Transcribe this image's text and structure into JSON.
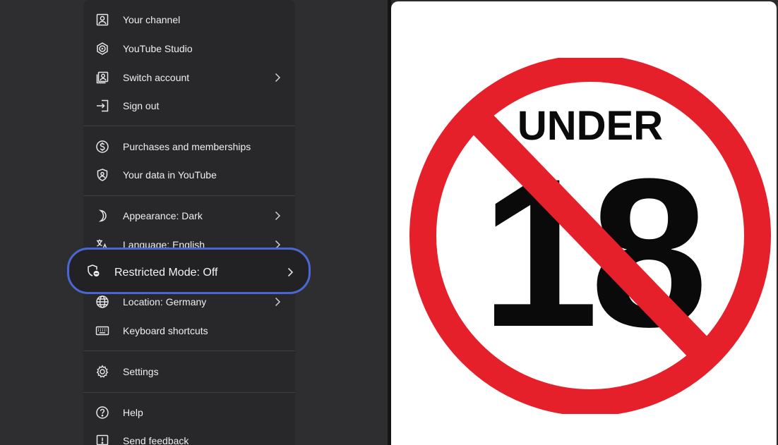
{
  "menu": {
    "account_items": [
      {
        "label": "Your channel",
        "icon": "account-box-icon"
      },
      {
        "label": "YouTube Studio",
        "icon": "studio-icon"
      },
      {
        "label": "Switch account",
        "icon": "switch-account-icon",
        "has_submenu": true
      },
      {
        "label": "Sign out",
        "icon": "sign-out-icon"
      }
    ],
    "data_items": [
      {
        "label": "Purchases and memberships",
        "icon": "dollar-icon"
      },
      {
        "label": "Your data in YouTube",
        "icon": "shield-person-icon"
      }
    ],
    "settings_items": [
      {
        "label": "Appearance: Dark",
        "icon": "moon-icon",
        "has_submenu": true
      },
      {
        "label": "Language: English",
        "icon": "translate-icon",
        "has_submenu": true
      },
      {
        "label": "Restricted Mode: Off",
        "icon": "restricted-mode-icon",
        "has_submenu": true,
        "highlighted": true
      },
      {
        "label": "Location: Germany",
        "icon": "globe-icon",
        "has_submenu": true
      },
      {
        "label": "Keyboard shortcuts",
        "icon": "keyboard-icon"
      }
    ],
    "settings": {
      "label": "Settings",
      "icon": "gear-icon"
    },
    "help_items": [
      {
        "label": "Help",
        "icon": "help-icon"
      },
      {
        "label": "Send feedback",
        "icon": "feedback-icon"
      }
    ]
  },
  "sign": {
    "top_text": "UNDER",
    "number": "18",
    "ring_color": "#e5202a",
    "text_color": "#0a0a0a",
    "background": "#ffffff"
  },
  "colors": {
    "menu_background": "#28282a",
    "highlight_border": "#4b67d6",
    "text": "#efefef"
  }
}
